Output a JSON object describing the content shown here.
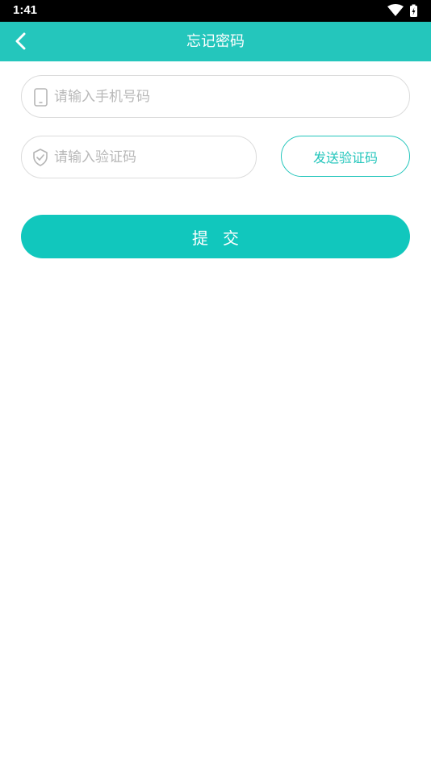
{
  "status_bar": {
    "time": "1:41",
    "icons": [
      "wifi-icon",
      "battery-charging-icon"
    ]
  },
  "app_bar": {
    "title": "忘记密码",
    "back_icon": "chevron-left-icon",
    "color": "#24c6bc"
  },
  "form": {
    "phone": {
      "icon": "phone-icon",
      "placeholder": "请输入手机号码",
      "value": ""
    },
    "code": {
      "icon": "shield-check-icon",
      "placeholder": "请输入验证码",
      "value": ""
    },
    "send_code_label": "发送验证码",
    "submit_label": "提交",
    "accent_color": "#11c7bd"
  }
}
